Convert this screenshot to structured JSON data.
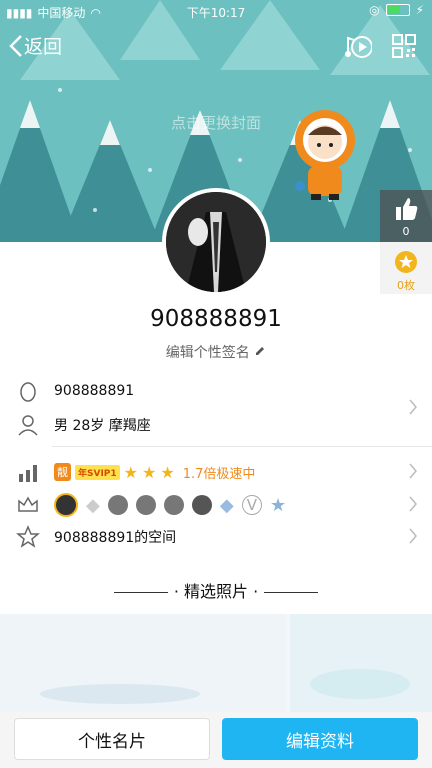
{
  "status_bar": {
    "carrier": "中国移动",
    "time": "下午10:17"
  },
  "nav": {
    "back_label": "返回"
  },
  "cover": {
    "hint": "点击更换封面"
  },
  "likes": {
    "count": "0"
  },
  "badges": {
    "count": "0枚"
  },
  "profile": {
    "username": "908888891",
    "signature_prompt": "编辑个性签名"
  },
  "info": {
    "qq_number": "908888891",
    "basic": "男 28岁 摩羯座",
    "vip_tag": "年SVIP1",
    "vip_mark": "靓",
    "speed": "1.7倍极速中",
    "space": "908888891的空间"
  },
  "photos": {
    "title": "精选照片"
  },
  "buttons": {
    "profile_card": "个性名片",
    "edit_profile": "编辑资料"
  },
  "colors": {
    "accent": "#1fb4f2",
    "cover": "#6cc0bf",
    "vip_orange": "#f08a1c"
  }
}
